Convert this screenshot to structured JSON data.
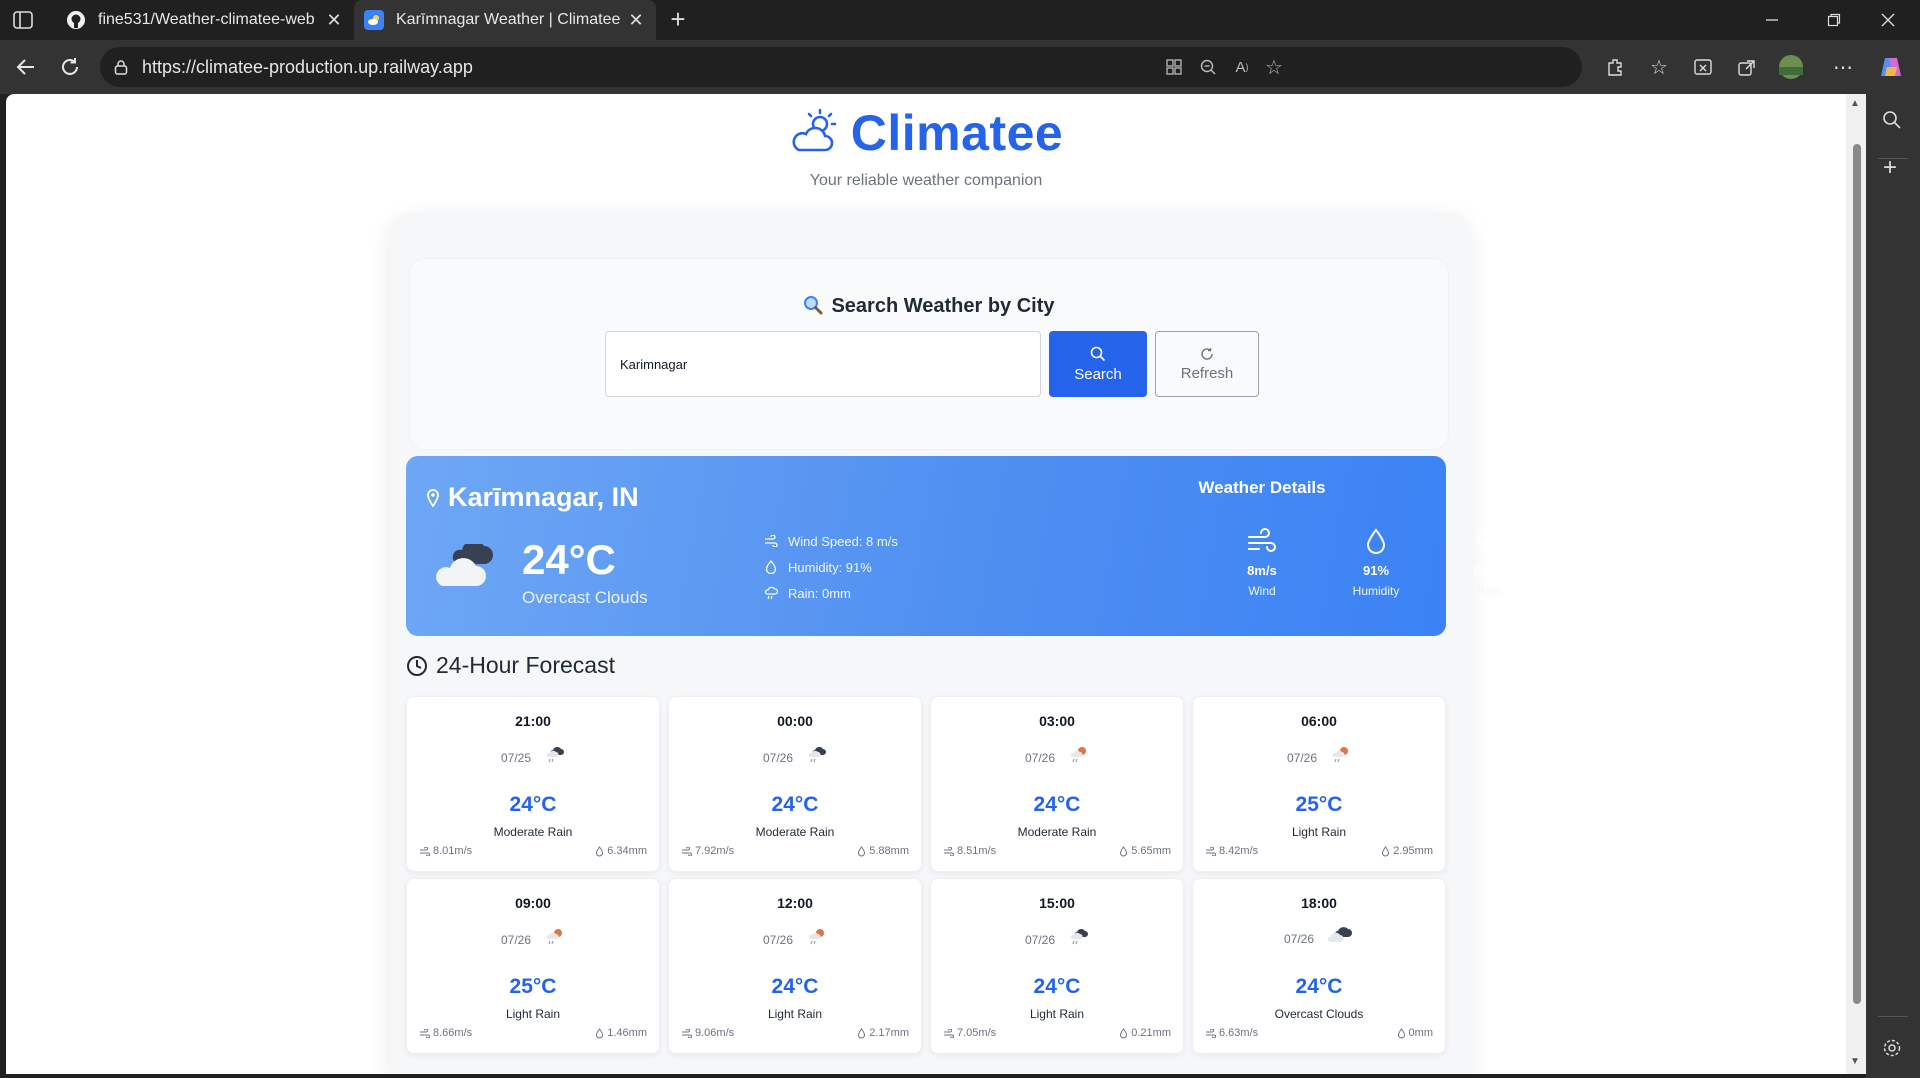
{
  "browser": {
    "tabs": [
      {
        "title": "fine531/Weather-climatee-web",
        "active": false,
        "icon": "github-icon"
      },
      {
        "title": "Karīmnagar Weather | Climatee",
        "active": true,
        "icon": "climatee-favicon"
      }
    ],
    "url": "https://climatee-production.up.railway.app"
  },
  "header": {
    "title": "Climatee",
    "tagline": "Your reliable weather companion"
  },
  "search": {
    "title": "Search Weather by City",
    "value": "Karimnagar",
    "search_label": "Search",
    "refresh_label": "Refresh"
  },
  "current": {
    "city": "Karīmnagar, IN",
    "temp": "24°C",
    "condition": "Overcast Clouds",
    "wind_line": "Wind Speed: 8 m/s",
    "humidity_line": "Humidity: 91%",
    "rain_line": "Rain: 0mm",
    "details_title": "Weather Details",
    "details": [
      {
        "value": "8m/s",
        "label": "Wind",
        "icon": "wind-icon"
      },
      {
        "value": "91%",
        "label": "Humidity",
        "icon": "droplet-icon"
      },
      {
        "value": "0mm",
        "label": "Rain",
        "icon": "rain-cloud-icon"
      }
    ]
  },
  "forecast": {
    "title": "24-Hour Forecast",
    "items": [
      {
        "time": "21:00",
        "date": "07/25",
        "temp": "24°C",
        "desc": "Moderate Rain",
        "wind": "8.01m/s",
        "rain": "6.34mm",
        "icon": "rain-night-icon"
      },
      {
        "time": "00:00",
        "date": "07/26",
        "temp": "24°C",
        "desc": "Moderate Rain",
        "wind": "7.92m/s",
        "rain": "5.88mm",
        "icon": "rain-night-icon"
      },
      {
        "time": "03:00",
        "date": "07/26",
        "temp": "24°C",
        "desc": "Moderate Rain",
        "wind": "8.51m/s",
        "rain": "5.65mm",
        "icon": "rain-day-icon"
      },
      {
        "time": "06:00",
        "date": "07/26",
        "temp": "25°C",
        "desc": "Light Rain",
        "wind": "8.42m/s",
        "rain": "2.95mm",
        "icon": "rain-day-icon"
      },
      {
        "time": "09:00",
        "date": "07/26",
        "temp": "25°C",
        "desc": "Light Rain",
        "wind": "8.66m/s",
        "rain": "1.46mm",
        "icon": "rain-day-icon"
      },
      {
        "time": "12:00",
        "date": "07/26",
        "temp": "24°C",
        "desc": "Light Rain",
        "wind": "9.06m/s",
        "rain": "2.17mm",
        "icon": "rain-day-icon"
      },
      {
        "time": "15:00",
        "date": "07/26",
        "temp": "24°C",
        "desc": "Light Rain",
        "wind": "7.05m/s",
        "rain": "0.21mm",
        "icon": "rain-night-icon"
      },
      {
        "time": "18:00",
        "date": "07/26",
        "temp": "24°C",
        "desc": "Overcast Clouds",
        "wind": "6.63m/s",
        "rain": "0mm",
        "icon": "overcast-icon"
      }
    ]
  },
  "colors": {
    "brand": "#2563eb",
    "card_gradient_start": "#6ea7f5",
    "card_gradient_end": "#3b82f6"
  }
}
